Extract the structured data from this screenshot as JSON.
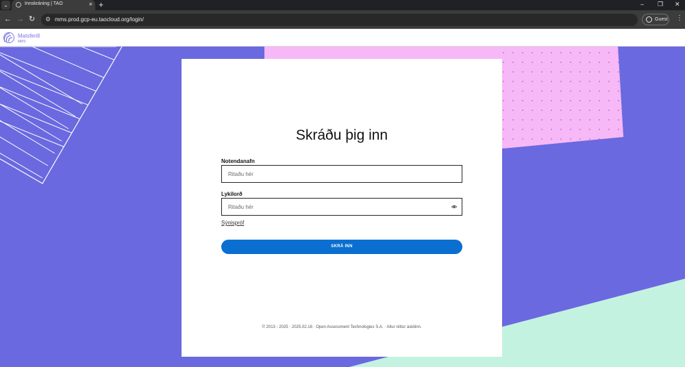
{
  "browser": {
    "tab_title": "Innskráning | TAO",
    "tab_menu_icon": "chevron-down-icon",
    "new_tab": "+",
    "url_host": "mms.prod.gcp-eu.taocloud.org",
    "url_path": "/login/",
    "profile_label": "Guest",
    "window_controls": [
      "–",
      "❐",
      "✕"
    ]
  },
  "header": {
    "logo_name": "Matsferill",
    "logo_sub": "MMS"
  },
  "login": {
    "title": "Skráðu þig inn",
    "username_label": "Notendanafn",
    "username_placeholder": "Ritaðu hér",
    "username_value": "",
    "password_label": "Lykilorð",
    "password_placeholder": "Ritaðu hér",
    "password_value": "",
    "demo_link": "Sýnispróf",
    "submit_label": "SKRÁ INN"
  },
  "footer": {
    "text": "© 2013 - 2025 · 2025.02.16 · Open Assessment Technologies S.A. · Allur réttur áskilinn."
  },
  "colors": {
    "background_purple": "#6a69e0",
    "pink_panel": "#f6b8f6",
    "mint_panel": "#c4f2e0",
    "button_blue": "#0a6fd0",
    "logo_purple": "#7b73e6"
  }
}
